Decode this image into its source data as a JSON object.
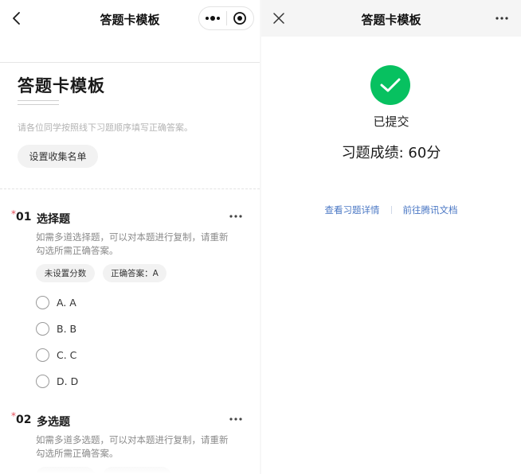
{
  "left": {
    "nav_title": "答题卡模板",
    "form_title": "答题卡模板",
    "form_desc": "请各位同学按照线下习题顺序填写正确答案。",
    "collect_button": "设置收集名单",
    "questions": [
      {
        "required": "*",
        "number": "01",
        "title": "选择题",
        "desc": "如需多道选择题，可以对本题进行复制，请重新勾选所需正确答案。",
        "tags": [
          "未设置分数",
          "正确答案：A"
        ],
        "options": [
          "A. A",
          "B. B",
          "C. C",
          "D. D"
        ]
      },
      {
        "required": "*",
        "number": "02",
        "title": "多选题",
        "desc": "如需多道多选题，可以对本题进行复制，请重新勾选所需正确答案。"
      }
    ]
  },
  "right": {
    "nav_title": "答题卡模板",
    "status": "已提交",
    "score": "习题成绩: 60分",
    "links": [
      "查看习题详情",
      "前往腾讯文档"
    ]
  },
  "colors": {
    "success": "#07c160",
    "link": "#4a77c4",
    "required": "#e34d59"
  }
}
